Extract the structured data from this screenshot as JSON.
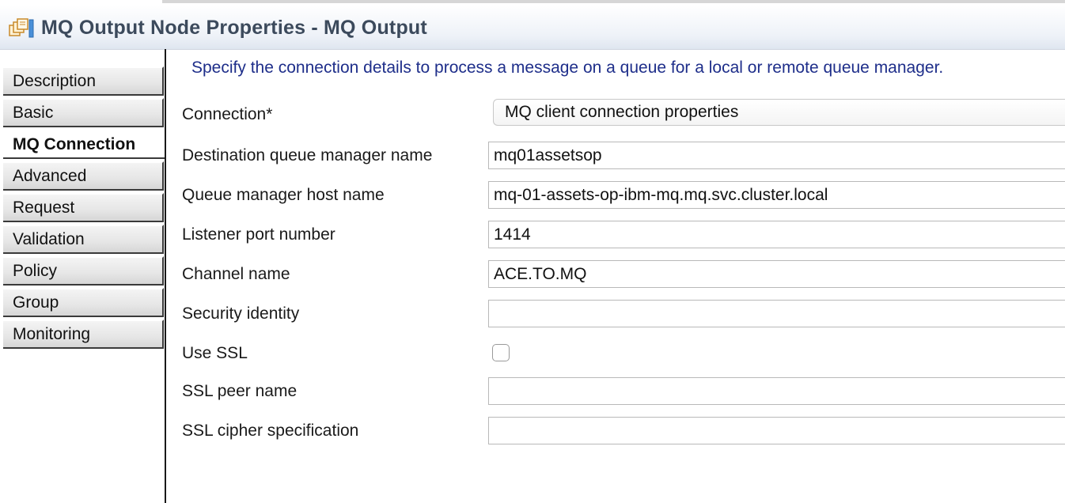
{
  "header": {
    "title": "MQ Output Node Properties - MQ Output",
    "icon": "properties-icon"
  },
  "tabs": [
    {
      "label": "Description",
      "active": false
    },
    {
      "label": "Basic",
      "active": false
    },
    {
      "label": "MQ Connection",
      "active": true
    },
    {
      "label": "Advanced",
      "active": false
    },
    {
      "label": "Request",
      "active": false
    },
    {
      "label": "Validation",
      "active": false
    },
    {
      "label": "Policy",
      "active": false
    },
    {
      "label": "Group",
      "active": false
    },
    {
      "label": "Monitoring",
      "active": false
    }
  ],
  "content": {
    "description": "Specify the connection details to process a message on a queue for a local or remote queue manager.",
    "connection": {
      "label": "Connection*",
      "value": "MQ client connection properties"
    },
    "dest_qmgr": {
      "label": "Destination queue manager name",
      "value": "mq01assetsop"
    },
    "host": {
      "label": "Queue manager host name",
      "value": "mq-01-assets-op-ibm-mq.mq.svc.cluster.local"
    },
    "port": {
      "label": "Listener port number",
      "value": "1414"
    },
    "channel": {
      "label": "Channel name",
      "value": "ACE.TO.MQ"
    },
    "security": {
      "label": "Security identity",
      "value": ""
    },
    "ssl": {
      "label": "Use SSL",
      "checked": false
    },
    "ssl_peer": {
      "label": "SSL peer name",
      "value": ""
    },
    "ssl_cipher": {
      "label": "SSL cipher specification",
      "value": ""
    }
  },
  "colors": {
    "description_text": "#1e2e8a",
    "title_text": "#3c4a5c"
  }
}
